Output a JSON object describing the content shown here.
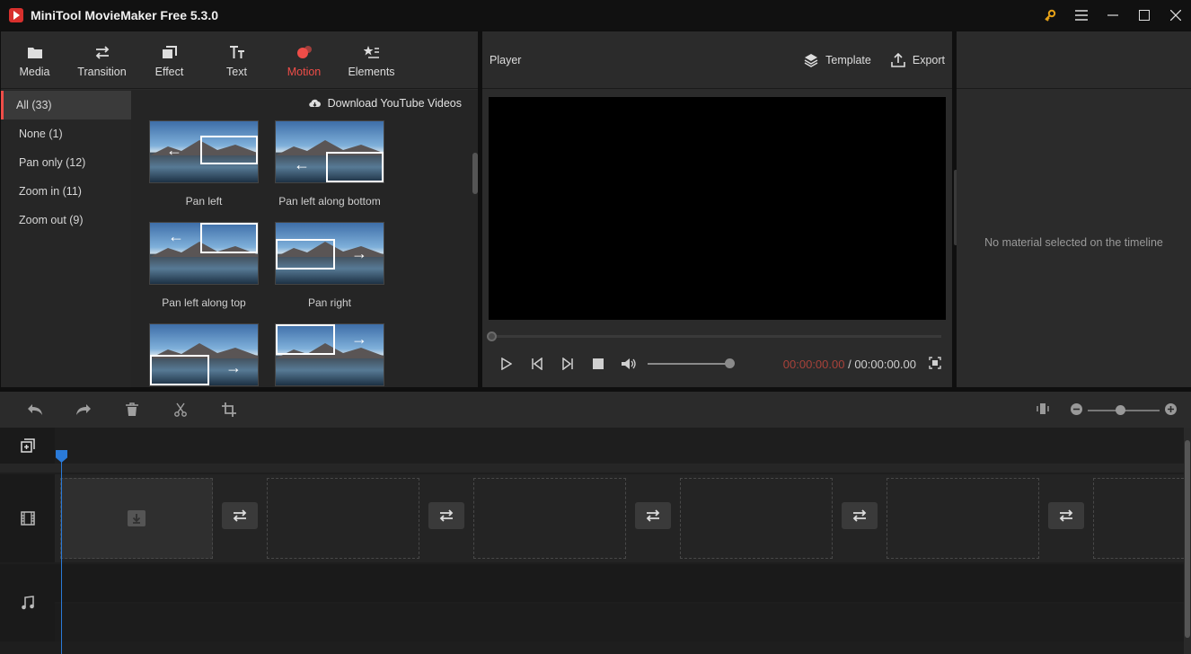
{
  "app": {
    "title": "MiniTool MovieMaker Free 5.3.0"
  },
  "window_controls": [
    "key-icon",
    "menu-icon",
    "minimize-icon",
    "maximize-icon",
    "close-icon"
  ],
  "colors": {
    "accent": "#ef4d48",
    "playhead": "#2a7ad8",
    "time_current": "#a8423a"
  },
  "toolbar": {
    "tabs": [
      {
        "label": "Media",
        "icon": "folder-icon"
      },
      {
        "label": "Transition",
        "icon": "swap-arrows-icon"
      },
      {
        "label": "Effect",
        "icon": "effect-icon"
      },
      {
        "label": "Text",
        "icon": "text-icon"
      },
      {
        "label": "Motion",
        "icon": "motion-icon",
        "active": true
      },
      {
        "label": "Elements",
        "icon": "elements-icon"
      }
    ]
  },
  "library": {
    "categories": [
      {
        "label": "All (33)",
        "active": true
      },
      {
        "label": "None (1)"
      },
      {
        "label": "Pan only (12)"
      },
      {
        "label": "Zoom in (11)"
      },
      {
        "label": "Zoom out (9)"
      }
    ],
    "download_label": "Download YouTube Videos",
    "items": [
      {
        "label": "Pan left"
      },
      {
        "label": "Pan left along bottom"
      },
      {
        "label": "Pan left along top"
      },
      {
        "label": "Pan right"
      },
      {
        "label": ""
      },
      {
        "label": ""
      }
    ]
  },
  "player": {
    "title": "Player",
    "template_label": "Template",
    "export_label": "Export",
    "current_time": "00:00:00.00",
    "separator": " / ",
    "total_time": "00:00:00.00",
    "seek_fraction": 0,
    "volume_fraction": 1
  },
  "properties": {
    "empty_message": "No material selected on the timeline"
  },
  "timeline_toolbar": {
    "tools": [
      "undo-icon",
      "redo-icon",
      "delete-icon",
      "split-icon",
      "crop-icon"
    ],
    "zoom_fraction": 0.45
  },
  "timeline": {
    "slot_count": 6
  }
}
